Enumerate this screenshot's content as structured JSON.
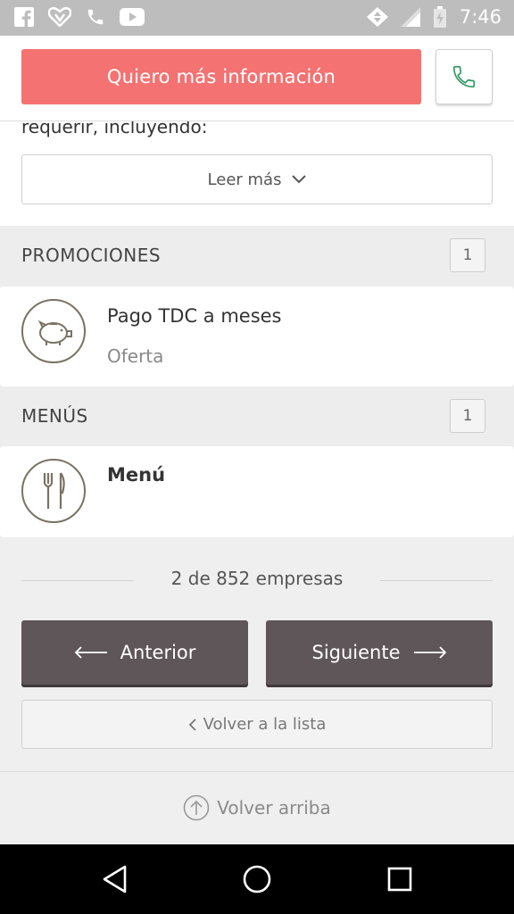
{
  "status_bar": {
    "time": "7:46",
    "left_icons": [
      "facebook-icon",
      "heart-app-icon",
      "phone-icon",
      "youtube-icon"
    ],
    "right_icons": [
      "data-arrows-icon",
      "signal-icon",
      "battery-charging-icon"
    ]
  },
  "top_bar": {
    "cta_label": "Quiero más información",
    "call_icon": "phone-icon",
    "cta_color": "#f47272"
  },
  "description": {
    "text": "requerir, incluyendo:",
    "read_more_label": "Leer más"
  },
  "promotions": {
    "title": "PROMOCIONES",
    "count": "1",
    "items": [
      {
        "title": "Pago TDC a meses",
        "subtitle": "Oferta",
        "icon": "piggy-bank-icon"
      }
    ]
  },
  "menus": {
    "title": "MENÚS",
    "count": "1",
    "items": [
      {
        "title": "Menú",
        "icon": "fork-knife-icon"
      }
    ]
  },
  "pager": {
    "text": "2 de 852 empresas",
    "prev_label": "Anterior",
    "next_label": "Siguiente",
    "back_list_label": "Volver a la lista",
    "back_top_label": "Volver arriba",
    "button_color": "#5e5659"
  },
  "android_nav": [
    "back-icon",
    "home-icon",
    "recents-icon"
  ]
}
